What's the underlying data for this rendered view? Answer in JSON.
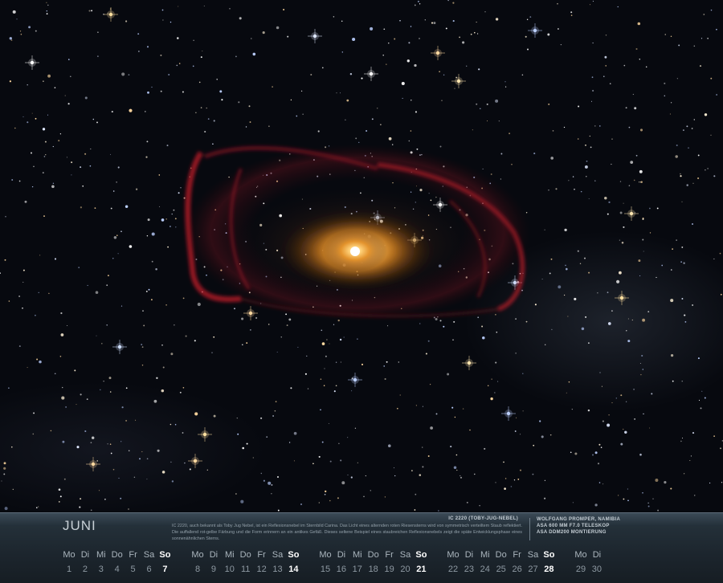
{
  "photo": {
    "subject": "IC 2220 (Toby-Jug-Nebel)"
  },
  "calendar": {
    "month": "JUNI",
    "description": "IC 2220, auch bekannt als Toby Jug Nebel, ist ein Reflexionsnebel im Sternbild Carina. Das Licht eines alternden roten Riesensterns wird von symmetrisch verteiltem Staub reflektiert. Die auffallend rot-gelbe Färbung und die Form erinnern an ein antikes Gefäß. Dieses seltene Beispiel eines staubreichen Reflexionsnebels zeigt die späte Entwicklungsphase eines sonnenähnlichen Sterns.",
    "caption_title": "IC 2220 (TOBY-JUG-NEBEL)",
    "credits": [
      "WOLFGANG PROMPER, NAMIBIA",
      "ASA 600 MM F7.0 TELESKOP",
      "ASA DDM200 MONTIERUNG"
    ],
    "weeks": [
      [
        {
          "d": "Mo",
          "n": "1"
        },
        {
          "d": "Di",
          "n": "2"
        },
        {
          "d": "Mi",
          "n": "3"
        },
        {
          "d": "Do",
          "n": "4"
        },
        {
          "d": "Fr",
          "n": "5"
        },
        {
          "d": "Sa",
          "n": "6"
        },
        {
          "d": "So",
          "n": "7"
        }
      ],
      [
        {
          "d": "Mo",
          "n": "8"
        },
        {
          "d": "Di",
          "n": "9"
        },
        {
          "d": "Mi",
          "n": "10"
        },
        {
          "d": "Do",
          "n": "11"
        },
        {
          "d": "Fr",
          "n": "12"
        },
        {
          "d": "Sa",
          "n": "13"
        },
        {
          "d": "So",
          "n": "14"
        }
      ],
      [
        {
          "d": "Mo",
          "n": "15"
        },
        {
          "d": "Di",
          "n": "16"
        },
        {
          "d": "Mi",
          "n": "17"
        },
        {
          "d": "Do",
          "n": "18"
        },
        {
          "d": "Fr",
          "n": "19"
        },
        {
          "d": "Sa",
          "n": "20"
        },
        {
          "d": "So",
          "n": "21"
        }
      ],
      [
        {
          "d": "Mo",
          "n": "22"
        },
        {
          "d": "Di",
          "n": "23"
        },
        {
          "d": "Mi",
          "n": "24"
        },
        {
          "d": "Do",
          "n": "25"
        },
        {
          "d": "Fr",
          "n": "26"
        },
        {
          "d": "Sa",
          "n": "27"
        },
        {
          "d": "So",
          "n": "28"
        }
      ],
      [
        {
          "d": "Mo",
          "n": "29"
        },
        {
          "d": "Di",
          "n": "30"
        }
      ]
    ]
  }
}
